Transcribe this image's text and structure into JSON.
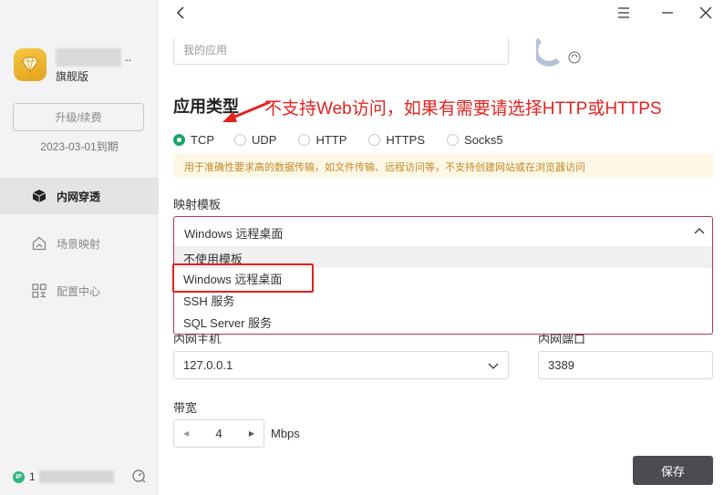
{
  "sidebar": {
    "plan_label": "旗舰版",
    "name_suffix": "..",
    "upgrade_label": "升级/续费",
    "expire_text": "2023-03-01到期",
    "items": [
      {
        "label": "内网穿透",
        "icon": "cube-icon",
        "active": true
      },
      {
        "label": "场景映射",
        "icon": "home-icon",
        "active": false
      },
      {
        "label": "配置中心",
        "icon": "grid-icon",
        "active": false
      }
    ],
    "ip_badge": "IP",
    "ip_prefix": "1"
  },
  "form": {
    "app_placeholder": "我的应用",
    "app_type_title": "应用类型",
    "annotation": "不支持Web访问，如果有需要请选择HTTP或HTTPS",
    "protocols": [
      {
        "label": "TCP",
        "checked": true
      },
      {
        "label": "UDP",
        "checked": false
      },
      {
        "label": "HTTP",
        "checked": false
      },
      {
        "label": "HTTPS",
        "checked": false
      },
      {
        "label": "Socks5",
        "checked": false
      }
    ],
    "hint": "用于准确性要求高的数据传输，如文件传输、远程访问等，不支持创建网站或在浏览器访问",
    "template_label": "映射模板",
    "template_selected": "Windows 远程桌面",
    "template_options": [
      "不使用模板",
      "Windows 远程桌面",
      "SSH 服务",
      "SQL Server 服务"
    ],
    "inner_host_label": "内网主机",
    "inner_host_value": "127.0.0.1",
    "inner_port_label": "内网端口",
    "inner_port_value": "3389",
    "bandwidth_label": "带宽",
    "bandwidth_value": "4",
    "bandwidth_unit": "Mbps",
    "save_label": "保存"
  },
  "colors": {
    "accent": "#19a56a",
    "annotation": "#e3231f",
    "select_border": "#b8325c",
    "save_button": "#4a4c52"
  }
}
